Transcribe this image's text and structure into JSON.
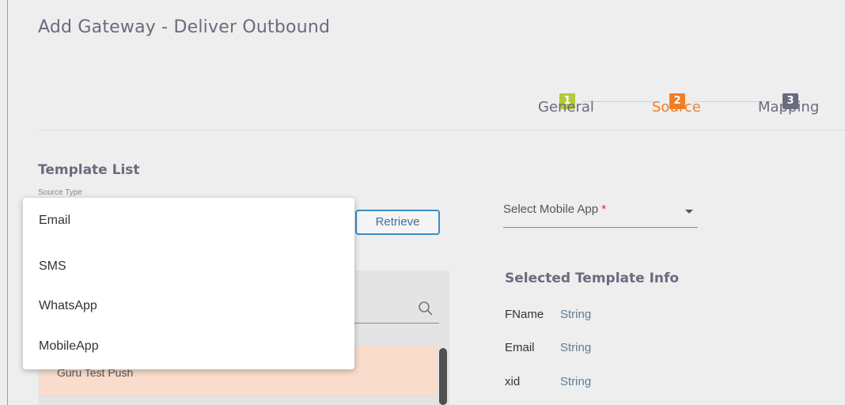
{
  "page": {
    "title": "Add Gateway - Deliver Outbound"
  },
  "stepper": {
    "steps": [
      {
        "number": "1",
        "label": "General",
        "color": "#b5c93a",
        "label_color": "#6b6b7e"
      },
      {
        "number": "2",
        "label": "Source",
        "color": "#f07e26",
        "label_color": "#f07e26"
      },
      {
        "number": "3",
        "label": "Mapping",
        "color": "#6b6b7e",
        "label_color": "#6b6b7e"
      }
    ]
  },
  "template_list": {
    "title": "Template List",
    "source_type_label": "Source Type",
    "retrieve_label": "Retrieve",
    "search_icon": "search-icon",
    "selected_row": "Guru Test Push"
  },
  "mobile_app": {
    "label": "Select Mobile App",
    "required_mark": "*"
  },
  "template_info": {
    "title": "Selected Template Info",
    "fields": [
      {
        "name": "FName",
        "type": "String"
      },
      {
        "name": "Email",
        "type": "String"
      },
      {
        "name": "xid",
        "type": "String"
      }
    ]
  },
  "source_type_dropdown": {
    "options": [
      "Email",
      "SMS",
      "WhatsApp",
      "MobileApp"
    ]
  },
  "colors": {
    "accent_orange": "#f07e26",
    "accent_green": "#b5c93a",
    "button_border": "#3b8ec4",
    "selected_row_bg": "#f9dccb"
  }
}
